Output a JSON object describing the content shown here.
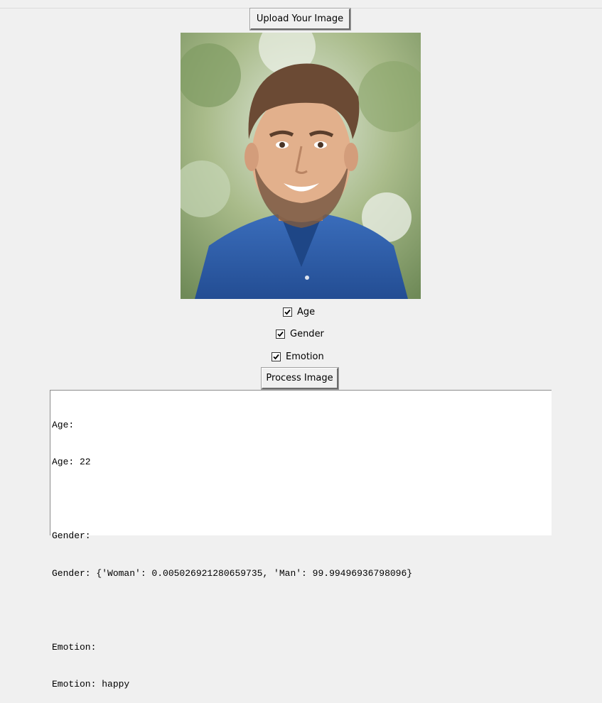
{
  "window": {
    "upload_button_label": "Upload Your Image",
    "process_button_label": "Process Image"
  },
  "options": [
    {
      "label": "Age",
      "checked": true
    },
    {
      "label": "Gender",
      "checked": true
    },
    {
      "label": "Emotion",
      "checked": true
    }
  ],
  "output": {
    "lines": [
      "Age:",
      "Age: 22",
      "",
      "Gender:",
      "Gender: {'Woman': 0.005026921280659735, 'Man': 99.99496936798096}",
      "",
      "Emotion:",
      "Emotion: happy"
    ]
  },
  "colors": {
    "background": "#f0f0f0",
    "shirt": "#2f5fa8",
    "skin": "#e2b08c",
    "hair": "#6b4a34"
  },
  "icons": {
    "checkbox": "checkmark-icon"
  }
}
